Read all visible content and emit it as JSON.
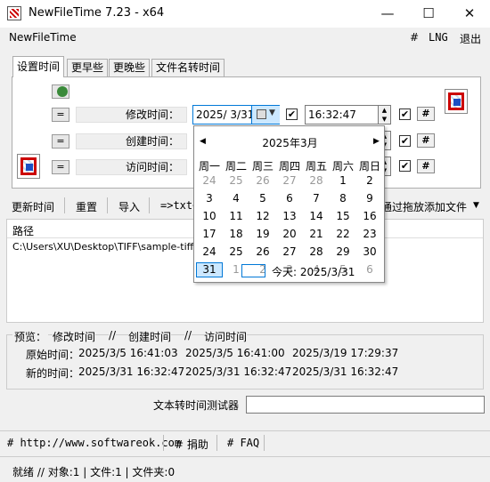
{
  "window": {
    "title": "NewFileTime 7.23 - x64",
    "minimize": "—",
    "maximize": "☐",
    "close": "✕"
  },
  "menubar": {
    "app": "NewFileTime",
    "hash": "#",
    "lng": "LNG",
    "exit": "退出"
  },
  "tabs": [
    "设置时间",
    "更早些",
    "更晚些",
    "文件名转时间"
  ],
  "rows": {
    "modified": {
      "eq": "=",
      "label": "修改时间：",
      "date": "2025/  3/31",
      "time": "16:32:47",
      "hash": "#",
      "checked": "✔"
    },
    "created": {
      "eq": "=",
      "label": "创建时间：",
      "hash": "#",
      "checked": "✔"
    },
    "accessed": {
      "eq": "=",
      "label": "访问时间：",
      "hash": "#",
      "checked": "✔"
    }
  },
  "toolbar": {
    "update": "更新时间",
    "reset": "重置",
    "import": "导入",
    "txt": "=>txt<",
    "drag": "通过拖放添加文件",
    "dropdown": "▼"
  },
  "list": {
    "header": "路径",
    "row1": "C:\\Users\\XU\\Desktop\\TIFF\\sample-tiff-file"
  },
  "preview": {
    "header": "预览：",
    "col_modified": "修改时间",
    "sep": "//",
    "col_created": "创建时间",
    "col_accessed": "访问时间",
    "original_label": "原始时间：",
    "original": [
      "2025/3/5 16:41:03",
      "2025/3/5 16:41:00",
      "2025/3/19 17:29:37"
    ],
    "new_label": "新的时间：",
    "new": [
      "2025/3/31 16:32:47",
      "2025/3/31 16:32:47",
      "2025/3/31 16:32:47"
    ]
  },
  "tester": {
    "label": "文本转时间测试器",
    "value": ""
  },
  "footer": {
    "website": "# http://www.softwareok.com",
    "donate": "# 捐助",
    "faq": "# FAQ"
  },
  "status": "就绪 // 对象:1 | 文件:1 | 文件夹:0",
  "calendar": {
    "month": "2025年3月",
    "prev": "◀",
    "next": "▶",
    "weekdays": [
      "周一",
      "周二",
      "周三",
      "周四",
      "周五",
      "周六",
      "周日"
    ],
    "days": [
      [
        "24",
        "25",
        "26",
        "27",
        "28",
        "1",
        "2"
      ],
      [
        "3",
        "4",
        "5",
        "6",
        "7",
        "8",
        "9"
      ],
      [
        "10",
        "11",
        "12",
        "13",
        "14",
        "15",
        "16"
      ],
      [
        "17",
        "18",
        "19",
        "20",
        "21",
        "22",
        "23"
      ],
      [
        "24",
        "25",
        "26",
        "27",
        "28",
        "29",
        "30"
      ],
      [
        "31",
        "1",
        "2",
        "3",
        "4",
        "5",
        "6"
      ]
    ],
    "today": "今天: 2025/3/31"
  }
}
